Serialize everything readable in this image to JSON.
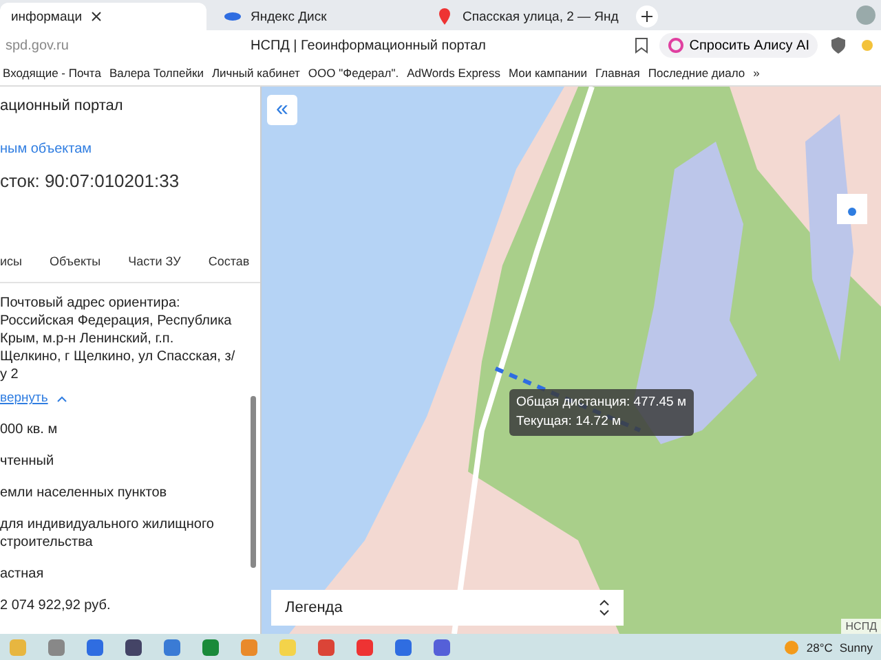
{
  "browser": {
    "tabs": [
      {
        "label": "информаци",
        "selected": true,
        "kind": "page"
      },
      {
        "label": "Яндекс Диск",
        "selected": false,
        "kind": "disk"
      },
      {
        "label": "Спасская улица, 2 — Янд",
        "selected": false,
        "kind": "maps"
      }
    ],
    "address": "spd.gov.ru",
    "page_title": "НСПД | Геоинформационный портал",
    "alice_button": "Спросить Алису AI",
    "bookmarks": [
      "Входящие - Почта",
      "Валера Толпейки",
      "Личный кабинет",
      "ООО \"Федерал\".",
      "AdWords Express",
      "Мои кампании",
      "Главная",
      "Последние диало"
    ],
    "bookmarks_more": "»"
  },
  "panel": {
    "portal_title": "ационный портал",
    "back_link": "ным объектам",
    "heading": "сток: 90:07:010201:33",
    "tabs": [
      {
        "label": "исы",
        "selected": false
      },
      {
        "label": "Объекты",
        "selected": false
      },
      {
        "label": "Части ЗУ",
        "selected": false
      },
      {
        "label": "Состав",
        "selected": false
      }
    ],
    "address_lines": [
      "Почтовый адрес ориентира:",
      "Российская Федерация, Республика",
      "Крым, м.р-н Ленинский, г.п.",
      "Щелкино, г Щелкино, ул Спасская, з/",
      "у 2"
    ],
    "collapse_link": "вернуть",
    "fields": [
      [
        "000 кв. м"
      ],
      [
        "чтенный"
      ],
      [
        "емли населенных пунктов"
      ],
      [
        "для индивидуального жилищного",
        "строительства"
      ],
      [
        "астная"
      ],
      [
        "2 074 922,92 руб."
      ]
    ]
  },
  "map": {
    "collapse_icon": "«",
    "tooltip": {
      "total": "Общая дистанция: 477.45 м",
      "current": "Текущая: 14.72 м"
    },
    "legend": "Легенда",
    "attribution": "НСПД"
  },
  "taskbar": {
    "temperature": "28°C",
    "weather": "Sunny"
  }
}
